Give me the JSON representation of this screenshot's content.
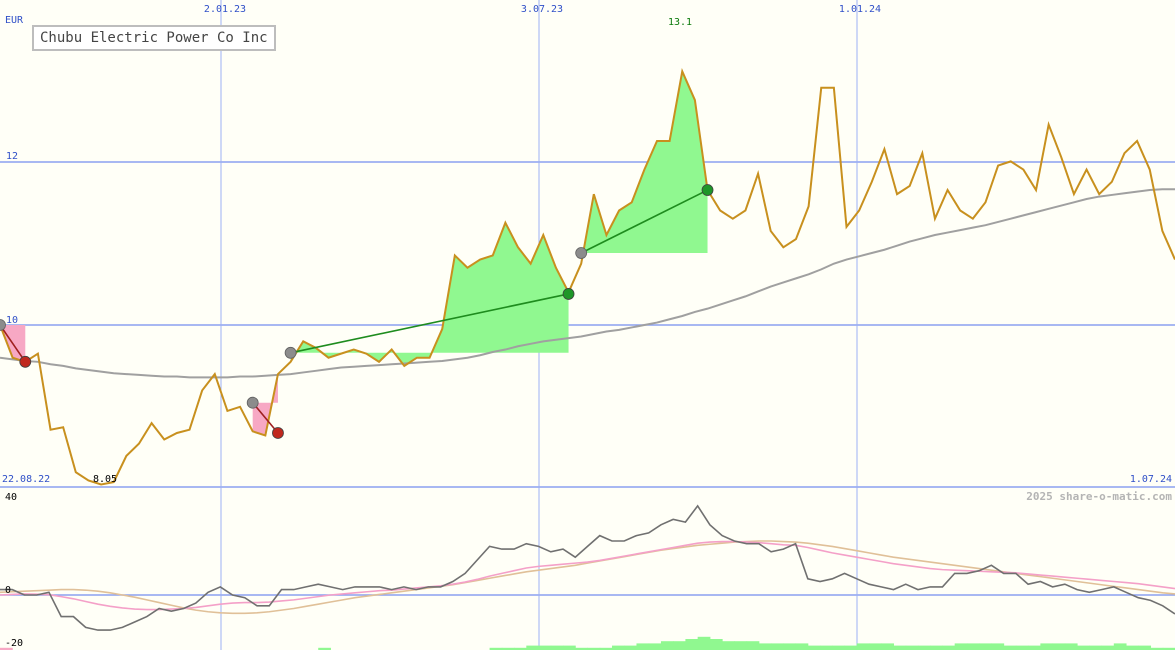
{
  "chart_data": [
    {
      "type": "line",
      "title": "Chubu Electric Power Co Inc",
      "unit": "EUR",
      "x_tick_labels": [
        "2.01.23",
        "3.07.23",
        "1.01.24"
      ],
      "y_tick_labels": [
        "12",
        "10"
      ],
      "ylim": [
        8.05,
        13.1
      ],
      "high_label": "13.1",
      "low_label": "8.05",
      "start_date": "22.08.22",
      "end_date": "1.07.24",
      "watermark": "2025 share-o-matic.com",
      "grid": true,
      "series": [
        {
          "color": "#c8901e",
          "values": [
            10.0,
            9.6,
            9.55,
            9.65,
            8.72,
            8.75,
            8.2,
            8.1,
            8.05,
            8.08,
            8.4,
            8.55,
            8.8,
            8.6,
            8.68,
            8.72,
            9.2,
            9.4,
            8.95,
            9.0,
            8.7,
            8.65,
            9.4,
            9.55,
            9.8,
            9.72,
            9.6,
            9.65,
            9.7,
            9.65,
            9.55,
            9.7,
            9.5,
            9.6,
            9.6,
            9.95,
            10.85,
            10.7,
            10.8,
            10.85,
            11.25,
            10.95,
            10.75,
            11.1,
            10.7,
            10.4,
            10.75,
            11.6,
            11.1,
            11.4,
            11.5,
            11.9,
            12.25,
            12.25,
            13.1,
            12.75,
            11.65,
            11.4,
            11.3,
            11.4,
            11.85,
            11.15,
            10.95,
            11.05,
            11.45,
            12.9,
            12.9,
            11.2,
            11.4,
            11.75,
            12.15,
            11.6,
            11.7,
            12.1,
            11.3,
            11.65,
            11.4,
            11.3,
            11.5,
            11.95,
            12.0,
            11.9,
            11.65,
            12.45,
            12.05,
            11.6,
            11.9,
            11.6,
            11.75,
            12.1,
            12.25,
            11.9,
            11.15,
            10.8
          ]
        },
        {
          "color": "#a0a0a0",
          "values": [
            9.6,
            9.58,
            9.56,
            9.55,
            9.52,
            9.5,
            9.47,
            9.45,
            9.43,
            9.41,
            9.4,
            9.39,
            9.38,
            9.37,
            9.37,
            9.36,
            9.36,
            9.36,
            9.36,
            9.37,
            9.37,
            9.38,
            9.39,
            9.4,
            9.42,
            9.44,
            9.46,
            9.48,
            9.49,
            9.5,
            9.51,
            9.52,
            9.53,
            9.54,
            9.55,
            9.56,
            9.58,
            9.6,
            9.63,
            9.67,
            9.7,
            9.74,
            9.77,
            9.8,
            9.82,
            9.84,
            9.86,
            9.89,
            9.92,
            9.94,
            9.97,
            10.0,
            10.03,
            10.07,
            10.11,
            10.16,
            10.2,
            10.25,
            10.3,
            10.35,
            10.41,
            10.47,
            10.52,
            10.57,
            10.62,
            10.68,
            10.75,
            10.8,
            10.84,
            10.88,
            10.92,
            10.97,
            11.02,
            11.06,
            11.1,
            11.13,
            11.16,
            11.19,
            11.22,
            11.26,
            11.3,
            11.34,
            11.38,
            11.42,
            11.46,
            11.5,
            11.54,
            11.57,
            11.59,
            11.61,
            11.63,
            11.65,
            11.66,
            11.66
          ]
        }
      ],
      "trades": [
        {
          "entry_index": 0,
          "exit_index": 2,
          "entry_value": 10.0,
          "exit_value": 9.55,
          "result": "loss"
        },
        {
          "entry_index": 20,
          "exit_index": 22,
          "entry_value": 9.05,
          "exit_value": 8.68,
          "result": "loss"
        },
        {
          "entry_index": 23,
          "exit_index": 45,
          "entry_value": 9.66,
          "exit_value": 10.38,
          "result": "gain"
        },
        {
          "entry_index": 46,
          "exit_index": 56,
          "entry_value": 10.88,
          "exit_value": 11.65,
          "result": "gain"
        }
      ],
      "marker_colors": {
        "entry": "#8c8c8c",
        "loss": "#c0281e",
        "gain": "#1e9628"
      },
      "zone_colors": {
        "loss": "#f7a8c4",
        "gain": "#90f890"
      }
    },
    {
      "type": "line",
      "y_tick_labels": [
        "40",
        "0",
        "-20"
      ],
      "ylim": [
        -20,
        40
      ],
      "series": [
        {
          "color": "#707070",
          "values": [
            2,
            2,
            0,
            0,
            1,
            -8,
            -8,
            -12,
            -13,
            -13,
            -12,
            -10,
            -8,
            -5,
            -6,
            -5,
            -3,
            1,
            3,
            0,
            -1,
            -4,
            -4,
            2,
            2,
            3,
            4,
            3,
            2,
            3,
            3,
            3,
            2,
            3,
            2,
            3,
            3,
            5,
            8,
            13,
            18,
            17,
            17,
            19,
            18,
            16,
            17,
            14,
            18,
            22,
            20,
            20,
            22,
            23,
            26,
            28,
            27,
            33,
            26,
            22,
            20,
            19,
            19,
            16,
            17,
            19,
            6,
            5,
            6,
            8,
            6,
            4,
            3,
            2,
            4,
            2,
            3,
            3,
            8,
            8,
            9,
            11,
            8,
            8,
            4,
            5,
            3,
            4,
            2,
            1,
            2,
            3,
            1,
            -1,
            -2,
            -4,
            -7
          ]
        },
        {
          "color": "#f4a0c8",
          "values": [
            0,
            0.2,
            0.4,
            0.3,
            0.1,
            -0.6,
            -1.4,
            -2.4,
            -3.4,
            -4.2,
            -4.8,
            -5.2,
            -5.4,
            -5.4,
            -5.2,
            -5,
            -4.6,
            -4,
            -3.4,
            -3,
            -2.8,
            -2.8,
            -2.6,
            -2.2,
            -1.8,
            -1.2,
            -0.6,
            0,
            0.4,
            0.8,
            1.2,
            1.6,
            1.8,
            2.2,
            2.6,
            3,
            3.4,
            4,
            4.8,
            5.8,
            7,
            8,
            9,
            10,
            10.6,
            11,
            11.4,
            11.8,
            12.2,
            12.8,
            13.6,
            14.4,
            15.2,
            16,
            16.8,
            17.6,
            18.4,
            19.2,
            19.6,
            19.8,
            19.8,
            19.6,
            19.4,
            19,
            18.6,
            18.4,
            17.6,
            16.6,
            15.6,
            14.8,
            14,
            13.2,
            12.4,
            11.6,
            11,
            10.4,
            9.8,
            9.4,
            9.2,
            9,
            8.8,
            8.6,
            8.4,
            8.2,
            7.8,
            7.4,
            7,
            6.6,
            6.2,
            5.8,
            5.4,
            5,
            4.6,
            4.2,
            3.6,
            3,
            2.4
          ]
        },
        {
          "color": "#e0c098",
          "values": [
            1,
            1.2,
            1.4,
            1.6,
            1.8,
            2,
            2,
            1.8,
            1.4,
            0.8,
            0,
            -0.8,
            -1.8,
            -2.8,
            -3.8,
            -4.8,
            -5.6,
            -6.2,
            -6.6,
            -6.8,
            -6.8,
            -6.6,
            -6.2,
            -5.6,
            -5,
            -4.2,
            -3.4,
            -2.6,
            -1.8,
            -1,
            -0.4,
            0.2,
            0.8,
            1.4,
            2,
            2.6,
            3.2,
            3.8,
            4.6,
            5.4,
            6.2,
            7,
            7.8,
            8.6,
            9.2,
            9.8,
            10.4,
            11,
            11.8,
            12.6,
            13.4,
            14.2,
            15,
            15.8,
            16.6,
            17.2,
            17.8,
            18.4,
            18.8,
            19.2,
            19.6,
            19.8,
            20,
            20,
            19.8,
            19.6,
            19.2,
            18.6,
            18,
            17.2,
            16.4,
            15.6,
            14.8,
            14,
            13.4,
            12.8,
            12.2,
            11.6,
            11,
            10.4,
            9.8,
            9.2,
            8.6,
            8,
            7.4,
            6.8,
            6.2,
            5.6,
            5,
            4.4,
            3.8,
            3.2,
            2.6,
            2,
            1.4,
            0.8,
            0.4
          ]
        }
      ],
      "bars": {
        "colors": {
          "positive": "#90f890",
          "negative": "#f7a8c4"
        },
        "values": [
          -1,
          0,
          0,
          0,
          0,
          0,
          0,
          0,
          0,
          0,
          0,
          0,
          0,
          0,
          0,
          0,
          0,
          0,
          0,
          0,
          0,
          0,
          0,
          0,
          0,
          0,
          1,
          0,
          0,
          0,
          0,
          0,
          0,
          0,
          0,
          0,
          0,
          0,
          0,
          0,
          1,
          1,
          1,
          2,
          2,
          2,
          2,
          1,
          1,
          1,
          2,
          2,
          3,
          3,
          4,
          4,
          5,
          6,
          5,
          4,
          4,
          4,
          3,
          3,
          3,
          3,
          2,
          2,
          2,
          2,
          3,
          3,
          3,
          2,
          2,
          2,
          2,
          2,
          3,
          3,
          3,
          3,
          2,
          2,
          2,
          3,
          3,
          3,
          2,
          2,
          2,
          3,
          2,
          2,
          1,
          1
        ]
      }
    }
  ]
}
